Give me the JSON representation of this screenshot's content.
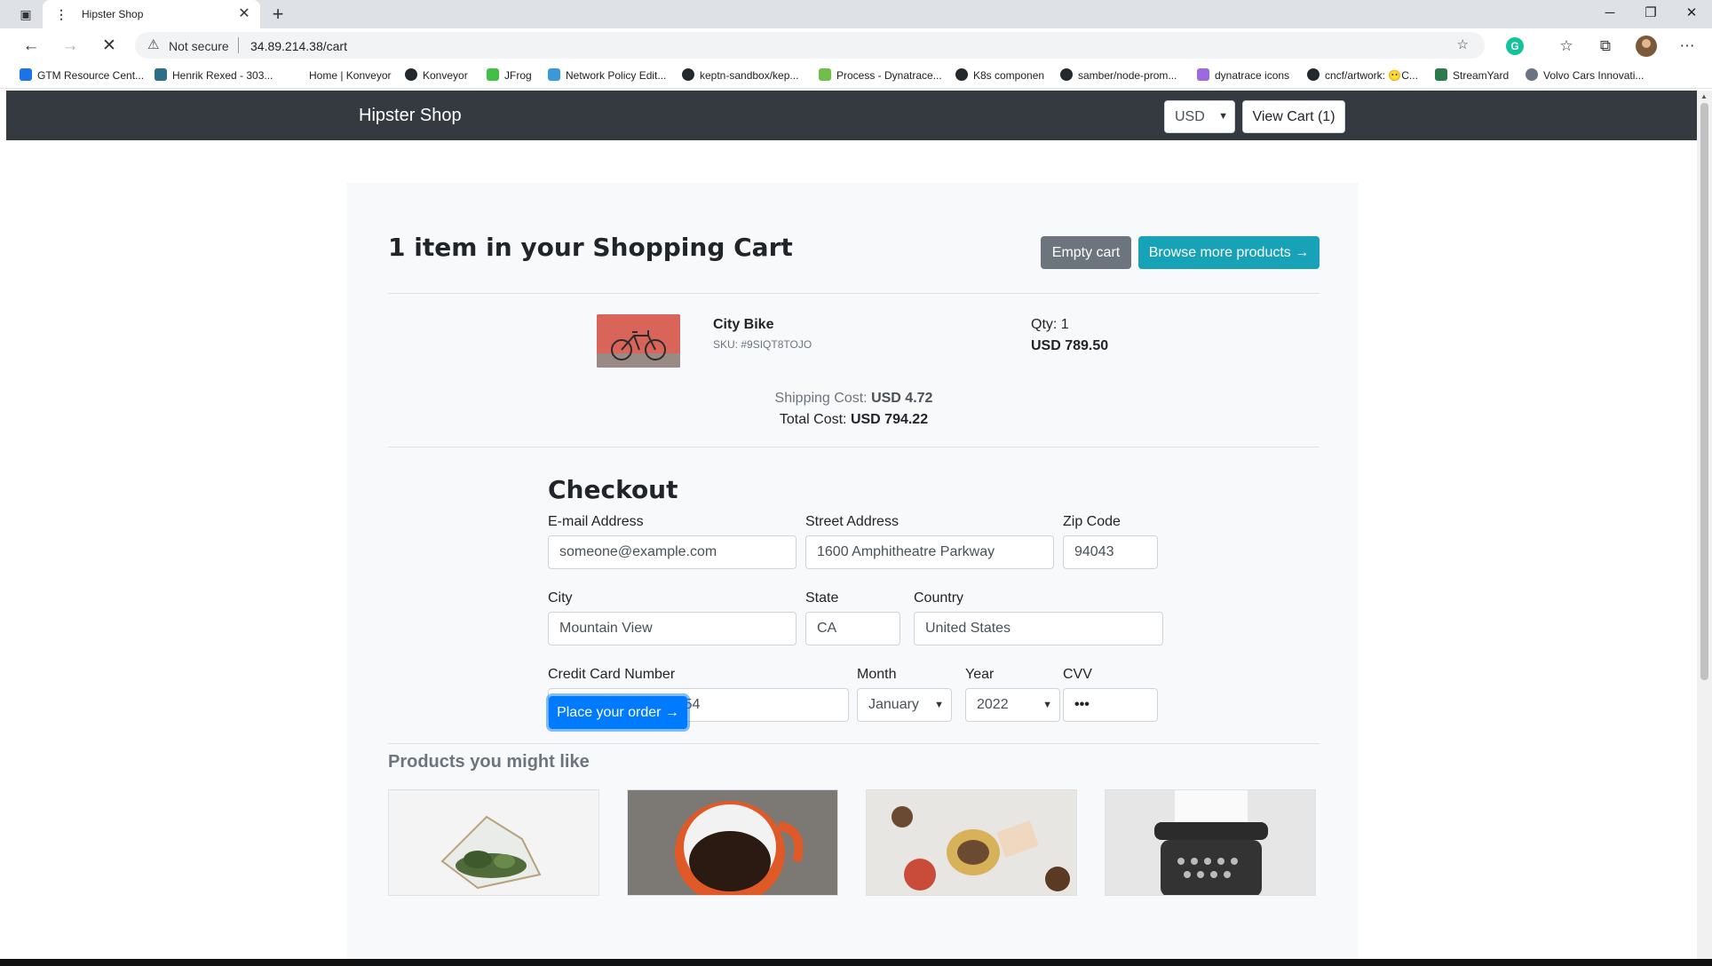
{
  "browser": {
    "tab_title": "Hipster Shop",
    "security_label": "Not secure",
    "url": "34.89.214.38/cart",
    "bookmarks": [
      {
        "label": "GTM Resource Cent...",
        "icon": "dynatrace-icon",
        "color": "#1a73e8"
      },
      {
        "label": "Henrik Rexed - 303...",
        "icon": "bookmark-favicon",
        "color": "#2a6e8a"
      },
      {
        "label": "Home | Konveyor",
        "icon": "blank-icon",
        "color": "#ffffff"
      },
      {
        "label": "Konveyor",
        "icon": "github-icon",
        "color": "#24292e"
      },
      {
        "label": "JFrog",
        "icon": "jfrog-icon",
        "color": "#41bf47"
      },
      {
        "label": "Network Policy Edit...",
        "icon": "cilium-icon",
        "color": "#3a9ad9"
      },
      {
        "label": "keptn-sandbox/kep...",
        "icon": "github-icon",
        "color": "#24292e"
      },
      {
        "label": "Process - Dynatrace...",
        "icon": "dynatrace-icon",
        "color": "#6fbf4a"
      },
      {
        "label": "K8s componen",
        "icon": "github-icon",
        "color": "#24292e"
      },
      {
        "label": "samber/node-prom...",
        "icon": "github-icon",
        "color": "#24292e"
      },
      {
        "label": "dynatrace icons",
        "icon": "dynatrace-icon",
        "color": "#9c6ade"
      },
      {
        "label": "cncf/artwork: 😶C...",
        "icon": "github-icon",
        "color": "#24292e"
      },
      {
        "label": "StreamYard",
        "icon": "streamyard-icon",
        "color": "#2c7a4b"
      },
      {
        "label": "Volvo Cars Innovati...",
        "icon": "volvo-icon",
        "color": "#6a7480"
      }
    ]
  },
  "header": {
    "brand": "Hipster Shop",
    "currency": "USD",
    "view_cart": "View Cart (1)"
  },
  "cart": {
    "title": "1 item in your Shopping Cart",
    "empty_button": "Empty cart",
    "browse_button": "Browse more products →",
    "item": {
      "name": "City Bike",
      "sku": "SKU: #9SIQT8TOJO",
      "qty": "Qty: 1",
      "price": "USD 789.50"
    },
    "shipping_label": "Shipping Cost:",
    "shipping_value": "USD 4.72",
    "total_label": "Total Cost:",
    "total_value": "USD 794.22"
  },
  "checkout": {
    "title": "Checkout",
    "email_label": "E-mail Address",
    "email_value": "someone@example.com",
    "street_label": "Street Address",
    "street_value": "1600 Amphitheatre Parkway",
    "zip_label": "Zip Code",
    "zip_value": "94043",
    "city_label": "City",
    "city_value": "Mountain View",
    "state_label": "State",
    "state_value": "CA",
    "country_label": "Country",
    "country_value": "United States",
    "card_label": "Credit Card Number",
    "card_value": "4432-8015-6152-0454",
    "month_label": "Month",
    "month_value": "January",
    "year_label": "Year",
    "year_value": "2022",
    "cvv_label": "CVV",
    "cvv_value": "•••",
    "order_button": "Place your order →"
  },
  "recommendations": {
    "title": "Products you might like"
  },
  "colors": {
    "navbar": "#343a40",
    "primary": "#007bff",
    "info": "#17a2b8",
    "secondary": "#6c757d"
  }
}
